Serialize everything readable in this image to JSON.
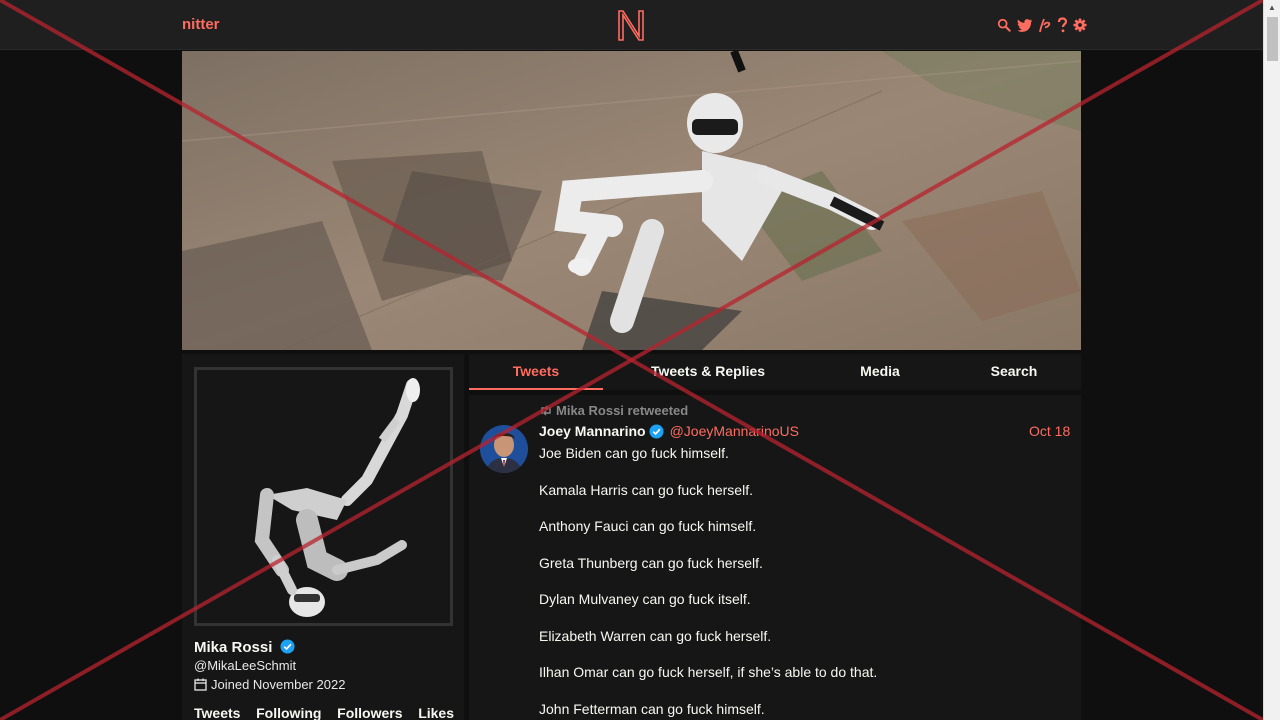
{
  "navbar": {
    "brand": "nitter",
    "logo_letter": "N",
    "icons": [
      "search-icon",
      "bird-icon",
      "rss-icon",
      "help-icon",
      "gear-icon"
    ]
  },
  "colors": {
    "accent": "#ff6c60",
    "background": "#0f0f0f",
    "panel": "#161616",
    "navbar": "#1f1f1f"
  },
  "profile": {
    "fullname": "Mika Rossi",
    "username": "@MikaLeeSchmit",
    "joined": "Joined November 2022",
    "stats": [
      "Tweets",
      "Following",
      "Followers",
      "Likes"
    ]
  },
  "tabs": [
    {
      "label": "Tweets",
      "active": true
    },
    {
      "label": "Tweets & Replies",
      "active": false
    },
    {
      "label": "Media",
      "active": false
    },
    {
      "label": "Search",
      "active": false
    }
  ],
  "tweet": {
    "retweet_label": "Mika Rossi retweeted",
    "author_name": "Joey Mannarino",
    "author_handle": "@JoeyMannarinoUS",
    "date": "Oct 18",
    "lines": [
      "Joe Biden can go fuck himself.",
      "Kamala Harris can go fuck herself.",
      "Anthony Fauci can go fuck himself.",
      "Greta Thunberg can go fuck herself.",
      "Dylan Mulvaney can go fuck itself.",
      "Elizabeth Warren can go fuck herself.",
      "Ilhan Omar can go fuck herself, if she’s able to do that.",
      "John Fetterman can go fuck himself."
    ]
  }
}
